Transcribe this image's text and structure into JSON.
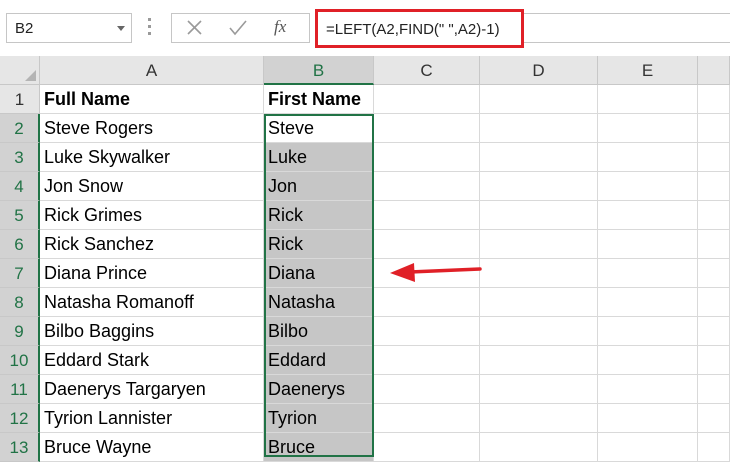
{
  "name_box": {
    "value": "B2"
  },
  "formula_bar": {
    "cancel_icon": "close-icon",
    "enter_icon": "checkmark-icon",
    "fx_label": "fx",
    "formula": "=LEFT(A2,FIND(\" \",A2)-1)"
  },
  "colors": {
    "highlight_box": "#e02027",
    "selection": "#217346",
    "selection_fill": "#c6c6c6",
    "arrow": "#e02027"
  },
  "columns": [
    "A",
    "B",
    "C",
    "D",
    "E"
  ],
  "rows": [
    {
      "num": "1",
      "a": "Full Name",
      "b": "First Name"
    },
    {
      "num": "2",
      "a": "Steve Rogers",
      "b": "Steve"
    },
    {
      "num": "3",
      "a": "Luke Skywalker",
      "b": "Luke"
    },
    {
      "num": "4",
      "a": "Jon Snow",
      "b": "Jon"
    },
    {
      "num": "5",
      "a": "Rick Grimes",
      "b": "Rick"
    },
    {
      "num": "6",
      "a": "Rick Sanchez",
      "b": "Rick"
    },
    {
      "num": "7",
      "a": "Diana Prince",
      "b": "Diana"
    },
    {
      "num": "8",
      "a": "Natasha Romanoff",
      "b": "Natasha"
    },
    {
      "num": "9",
      "a": "Bilbo Baggins",
      "b": "Bilbo"
    },
    {
      "num": "10",
      "a": "Eddard Stark",
      "b": "Eddard"
    },
    {
      "num": "11",
      "a": "Daenerys Targaryen",
      "b": "Daenerys"
    },
    {
      "num": "12",
      "a": "Tyrion Lannister",
      "b": "Tyrion"
    },
    {
      "num": "13",
      "a": "Bruce Wayne",
      "b": "Bruce"
    }
  ]
}
